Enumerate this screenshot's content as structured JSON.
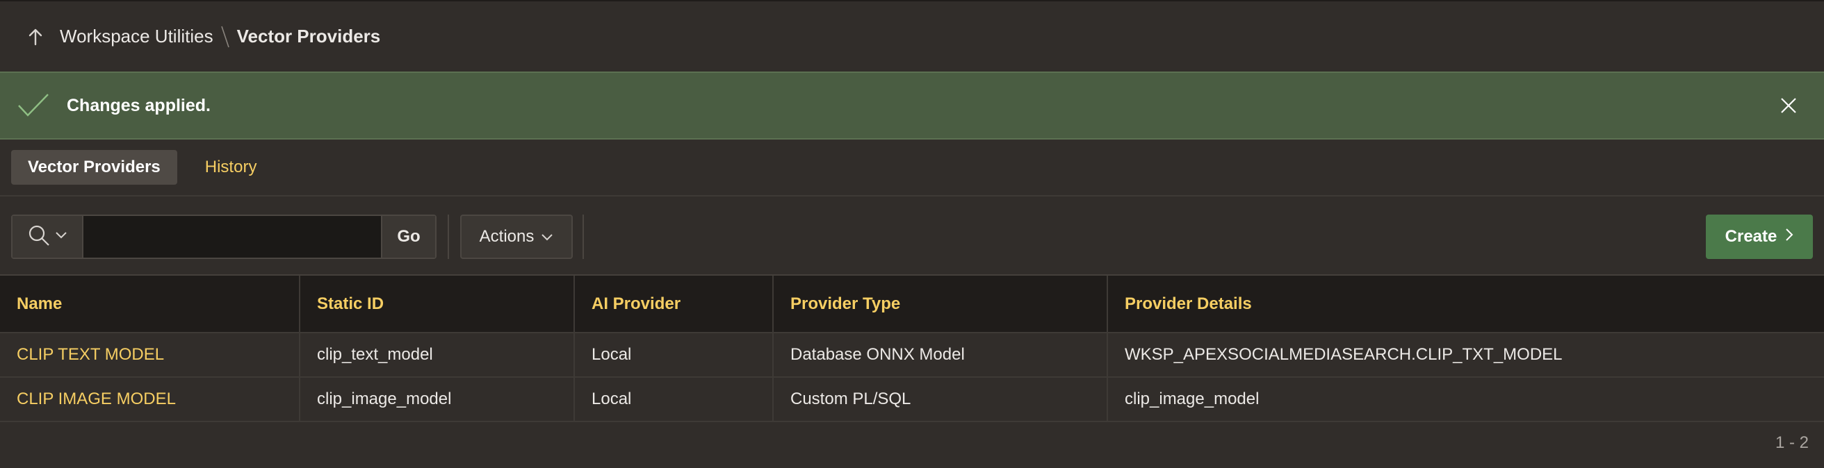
{
  "breadcrumb": {
    "parent": "Workspace Utilities",
    "current": "Vector Providers"
  },
  "banner": {
    "message": "Changes applied."
  },
  "tabs": [
    {
      "label": "Vector Providers",
      "active": true
    },
    {
      "label": "History",
      "active": false
    }
  ],
  "toolbar": {
    "search_value": "",
    "go_label": "Go",
    "actions_label": "Actions",
    "create_label": "Create"
  },
  "table": {
    "columns": [
      "Name",
      "Static ID",
      "AI Provider",
      "Provider Type",
      "Provider Details"
    ],
    "rows": [
      [
        "CLIP TEXT MODEL",
        "clip_text_model",
        "Local",
        "Database ONNX Model",
        "WKSP_APEXSOCIALMEDIASEARCH.CLIP_TXT_MODEL"
      ],
      [
        "CLIP IMAGE MODEL",
        "clip_image_model",
        "Local",
        "Custom PL/SQL",
        "clip_image_model"
      ]
    ]
  },
  "pagination": "1 - 2",
  "colors": {
    "background": "#312d2a",
    "banner": "#4a5d42",
    "accent_link": "#f6ce63",
    "create_button": "#4b7a4a"
  },
  "icons": {
    "up": "arrow-up-icon",
    "check": "check-icon",
    "close": "close-icon",
    "search": "search-icon",
    "chevron_down": "chevron-down-icon",
    "chevron_right": "chevron-right-icon"
  }
}
